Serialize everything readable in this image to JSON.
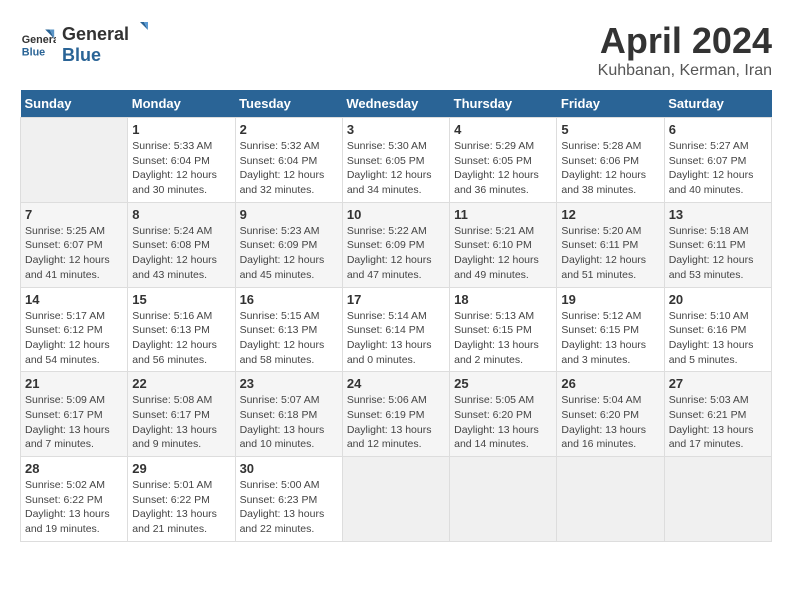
{
  "header": {
    "logo_general": "General",
    "logo_blue": "Blue",
    "title": "April 2024",
    "location": "Kuhbanan, Kerman, Iran"
  },
  "calendar": {
    "weekdays": [
      "Sunday",
      "Monday",
      "Tuesday",
      "Wednesday",
      "Thursday",
      "Friday",
      "Saturday"
    ],
    "weeks": [
      [
        {
          "day": null
        },
        {
          "day": "1",
          "sunrise": "5:33 AM",
          "sunset": "6:04 PM",
          "daylight": "12 hours and 30 minutes."
        },
        {
          "day": "2",
          "sunrise": "5:32 AM",
          "sunset": "6:04 PM",
          "daylight": "12 hours and 32 minutes."
        },
        {
          "day": "3",
          "sunrise": "5:30 AM",
          "sunset": "6:05 PM",
          "daylight": "12 hours and 34 minutes."
        },
        {
          "day": "4",
          "sunrise": "5:29 AM",
          "sunset": "6:05 PM",
          "daylight": "12 hours and 36 minutes."
        },
        {
          "day": "5",
          "sunrise": "5:28 AM",
          "sunset": "6:06 PM",
          "daylight": "12 hours and 38 minutes."
        },
        {
          "day": "6",
          "sunrise": "5:27 AM",
          "sunset": "6:07 PM",
          "daylight": "12 hours and 40 minutes."
        }
      ],
      [
        {
          "day": "7",
          "sunrise": "5:25 AM",
          "sunset": "6:07 PM",
          "daylight": "12 hours and 41 minutes."
        },
        {
          "day": "8",
          "sunrise": "5:24 AM",
          "sunset": "6:08 PM",
          "daylight": "12 hours and 43 minutes."
        },
        {
          "day": "9",
          "sunrise": "5:23 AM",
          "sunset": "6:09 PM",
          "daylight": "12 hours and 45 minutes."
        },
        {
          "day": "10",
          "sunrise": "5:22 AM",
          "sunset": "6:09 PM",
          "daylight": "12 hours and 47 minutes."
        },
        {
          "day": "11",
          "sunrise": "5:21 AM",
          "sunset": "6:10 PM",
          "daylight": "12 hours and 49 minutes."
        },
        {
          "day": "12",
          "sunrise": "5:20 AM",
          "sunset": "6:11 PM",
          "daylight": "12 hours and 51 minutes."
        },
        {
          "day": "13",
          "sunrise": "5:18 AM",
          "sunset": "6:11 PM",
          "daylight": "12 hours and 53 minutes."
        }
      ],
      [
        {
          "day": "14",
          "sunrise": "5:17 AM",
          "sunset": "6:12 PM",
          "daylight": "12 hours and 54 minutes."
        },
        {
          "day": "15",
          "sunrise": "5:16 AM",
          "sunset": "6:13 PM",
          "daylight": "12 hours and 56 minutes."
        },
        {
          "day": "16",
          "sunrise": "5:15 AM",
          "sunset": "6:13 PM",
          "daylight": "12 hours and 58 minutes."
        },
        {
          "day": "17",
          "sunrise": "5:14 AM",
          "sunset": "6:14 PM",
          "daylight": "13 hours and 0 minutes."
        },
        {
          "day": "18",
          "sunrise": "5:13 AM",
          "sunset": "6:15 PM",
          "daylight": "13 hours and 2 minutes."
        },
        {
          "day": "19",
          "sunrise": "5:12 AM",
          "sunset": "6:15 PM",
          "daylight": "13 hours and 3 minutes."
        },
        {
          "day": "20",
          "sunrise": "5:10 AM",
          "sunset": "6:16 PM",
          "daylight": "13 hours and 5 minutes."
        }
      ],
      [
        {
          "day": "21",
          "sunrise": "5:09 AM",
          "sunset": "6:17 PM",
          "daylight": "13 hours and 7 minutes."
        },
        {
          "day": "22",
          "sunrise": "5:08 AM",
          "sunset": "6:17 PM",
          "daylight": "13 hours and 9 minutes."
        },
        {
          "day": "23",
          "sunrise": "5:07 AM",
          "sunset": "6:18 PM",
          "daylight": "13 hours and 10 minutes."
        },
        {
          "day": "24",
          "sunrise": "5:06 AM",
          "sunset": "6:19 PM",
          "daylight": "13 hours and 12 minutes."
        },
        {
          "day": "25",
          "sunrise": "5:05 AM",
          "sunset": "6:20 PM",
          "daylight": "13 hours and 14 minutes."
        },
        {
          "day": "26",
          "sunrise": "5:04 AM",
          "sunset": "6:20 PM",
          "daylight": "13 hours and 16 minutes."
        },
        {
          "day": "27",
          "sunrise": "5:03 AM",
          "sunset": "6:21 PM",
          "daylight": "13 hours and 17 minutes."
        }
      ],
      [
        {
          "day": "28",
          "sunrise": "5:02 AM",
          "sunset": "6:22 PM",
          "daylight": "13 hours and 19 minutes."
        },
        {
          "day": "29",
          "sunrise": "5:01 AM",
          "sunset": "6:22 PM",
          "daylight": "13 hours and 21 minutes."
        },
        {
          "day": "30",
          "sunrise": "5:00 AM",
          "sunset": "6:23 PM",
          "daylight": "13 hours and 22 minutes."
        },
        {
          "day": null
        },
        {
          "day": null
        },
        {
          "day": null
        },
        {
          "day": null
        }
      ]
    ]
  }
}
